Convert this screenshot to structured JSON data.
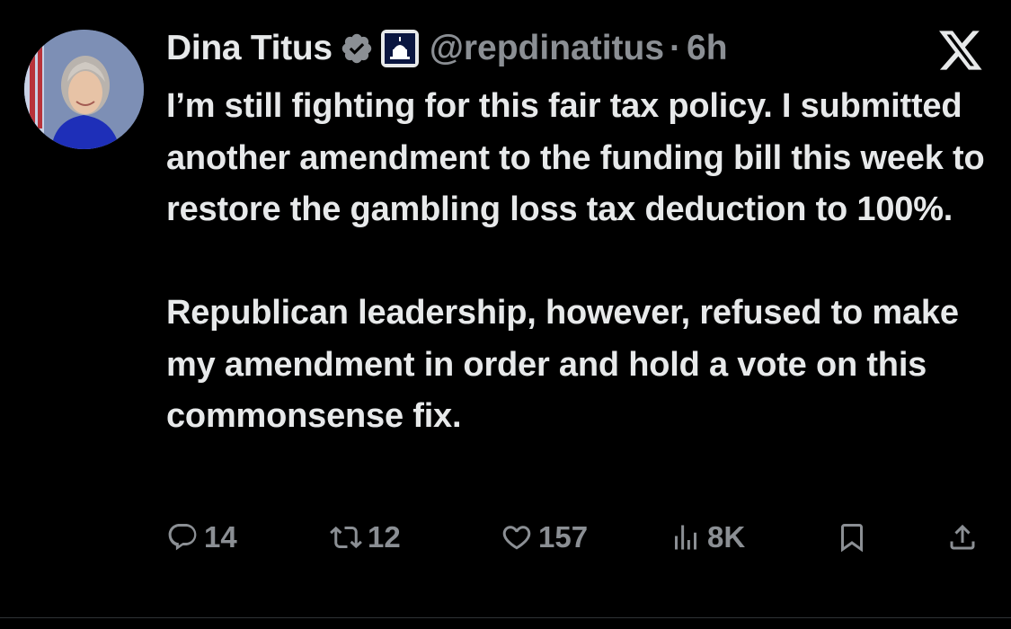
{
  "author": {
    "name": "Dina Titus",
    "handle": "@repdinatitus",
    "separator": "·",
    "time": "6h"
  },
  "icons": {
    "verified": "verified-badge-icon",
    "affiliation": "capitol-affiliation-badge-icon",
    "logo": "x-logo-icon"
  },
  "tweet": {
    "paragraphs": [
      "I’m still fighting for this fair tax policy. I submitted another amendment to the funding bill this week to restore the gambling loss tax deduction to 100%.",
      "Republican leadership, however, refused to make my amendment in order and hold a vote on this commonsense fix."
    ]
  },
  "actions": {
    "replies": "14",
    "reposts": "12",
    "likes": "157",
    "views": "8K"
  },
  "colors": {
    "background": "#000000",
    "text": "#e7e9ea",
    "secondary": "#8b8f94",
    "verified_badge": "#8b8f94"
  }
}
